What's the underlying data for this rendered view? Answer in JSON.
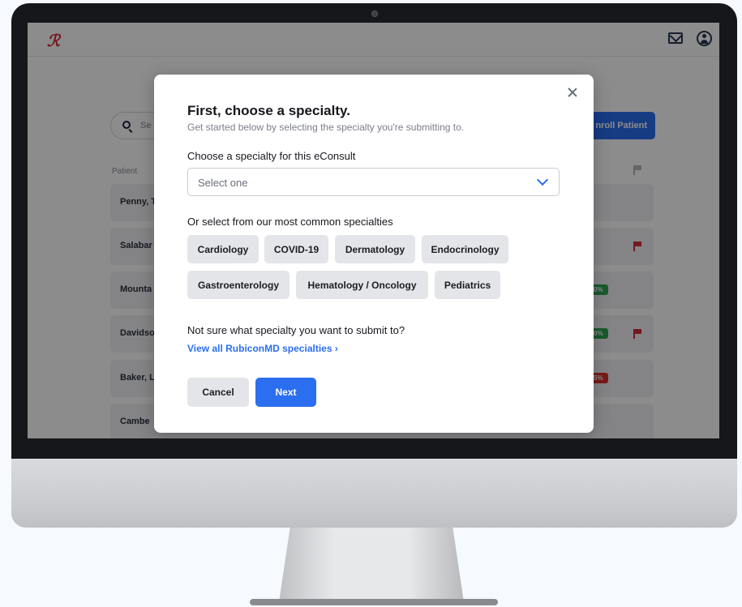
{
  "app": {
    "logo_text": "ℛ",
    "search_placeholder": "Se",
    "enroll_button_label": "nroll Patient",
    "column_patient": "Patient",
    "patients": [
      {
        "name": "Penny, T",
        "badge": "",
        "badge_color": "",
        "flag": false
      },
      {
        "name": "Salabar",
        "badge": "",
        "badge_color": "",
        "flag": true
      },
      {
        "name": "Mounta",
        "badge": "0%",
        "badge_color": "#2ea44f",
        "flag": false
      },
      {
        "name": "Davidso",
        "badge": "0%",
        "badge_color": "#2ea44f",
        "flag": true
      },
      {
        "name": "Baker, L",
        "badge": "5%",
        "badge_color": "#d9302c",
        "flag": false
      },
      {
        "name": "Cambe",
        "badge": "",
        "badge_color": "",
        "flag": false
      }
    ]
  },
  "modal": {
    "title": "First, choose a specialty.",
    "subtitle": "Get started below by selecting the specialty you're submitting to.",
    "select_label": "Choose a specialty for this eConsult",
    "select_value": "Select one",
    "common_label": "Or select from our most common specialties",
    "specialties_row1": [
      "Cardiology",
      "COVID-19",
      "Dermatology",
      "Endocrinology"
    ],
    "specialties_row2": [
      "Gastroenterology",
      "Hematology / Oncology",
      "Pediatrics"
    ],
    "not_sure_text": "Not sure what specialty you want to submit to?",
    "view_all_link": "View all RubiconMD specialties ›",
    "cancel_label": "Cancel",
    "next_label": "Next"
  },
  "colors": {
    "accent": "#2b6ef0",
    "flag": "#d62b3a",
    "chip_bg": "#e4e5e8"
  }
}
